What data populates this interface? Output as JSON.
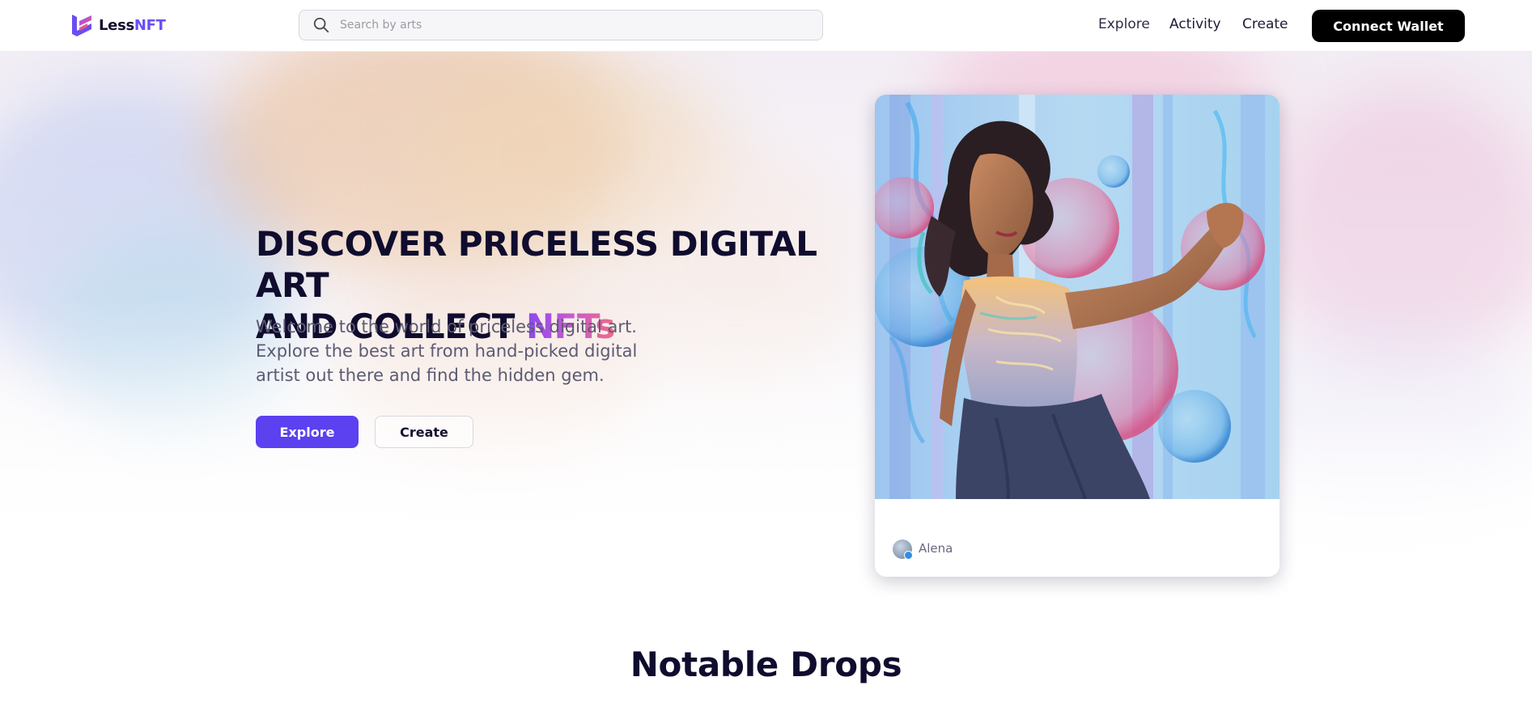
{
  "header": {
    "logo": {
      "name_part1": "Less",
      "name_part2": "NFT",
      "icon": "lessnft-logo-icon"
    },
    "search": {
      "placeholder": "Search by arts",
      "value": "",
      "icon": "search-icon"
    },
    "nav": [
      {
        "label": "Explore"
      },
      {
        "label": "Activity"
      },
      {
        "label": "Create"
      }
    ],
    "connect_wallet_label": "Connect Wallet"
  },
  "hero": {
    "title_line1": "DISCOVER PRICELESS DIGITAL ART",
    "title_line2_prefix": "AND COLLECT ",
    "title_highlight": "NFTs",
    "description": "Welcome to the world of priceless digital art. Explore the best art from hand-picked digital artist out there and find the hidden gem.",
    "explore_label": "Explore",
    "create_label": "Create"
  },
  "featured_card": {
    "artist_name": "Alena",
    "artist_verified": true,
    "artwork": "painting of a dancing woman with colorful bubbles"
  },
  "sections": {
    "notable_drops_title": "Notable Drops"
  },
  "colors": {
    "brand_purple": "#5b41ef",
    "logo_accent": "#6b4df2",
    "title_dark": "#0f0c2e",
    "gradient_start": "#8b47f0",
    "gradient_end": "#f06a86",
    "wallet_button": "#000000",
    "verified_badge": "#2f8ee8"
  }
}
